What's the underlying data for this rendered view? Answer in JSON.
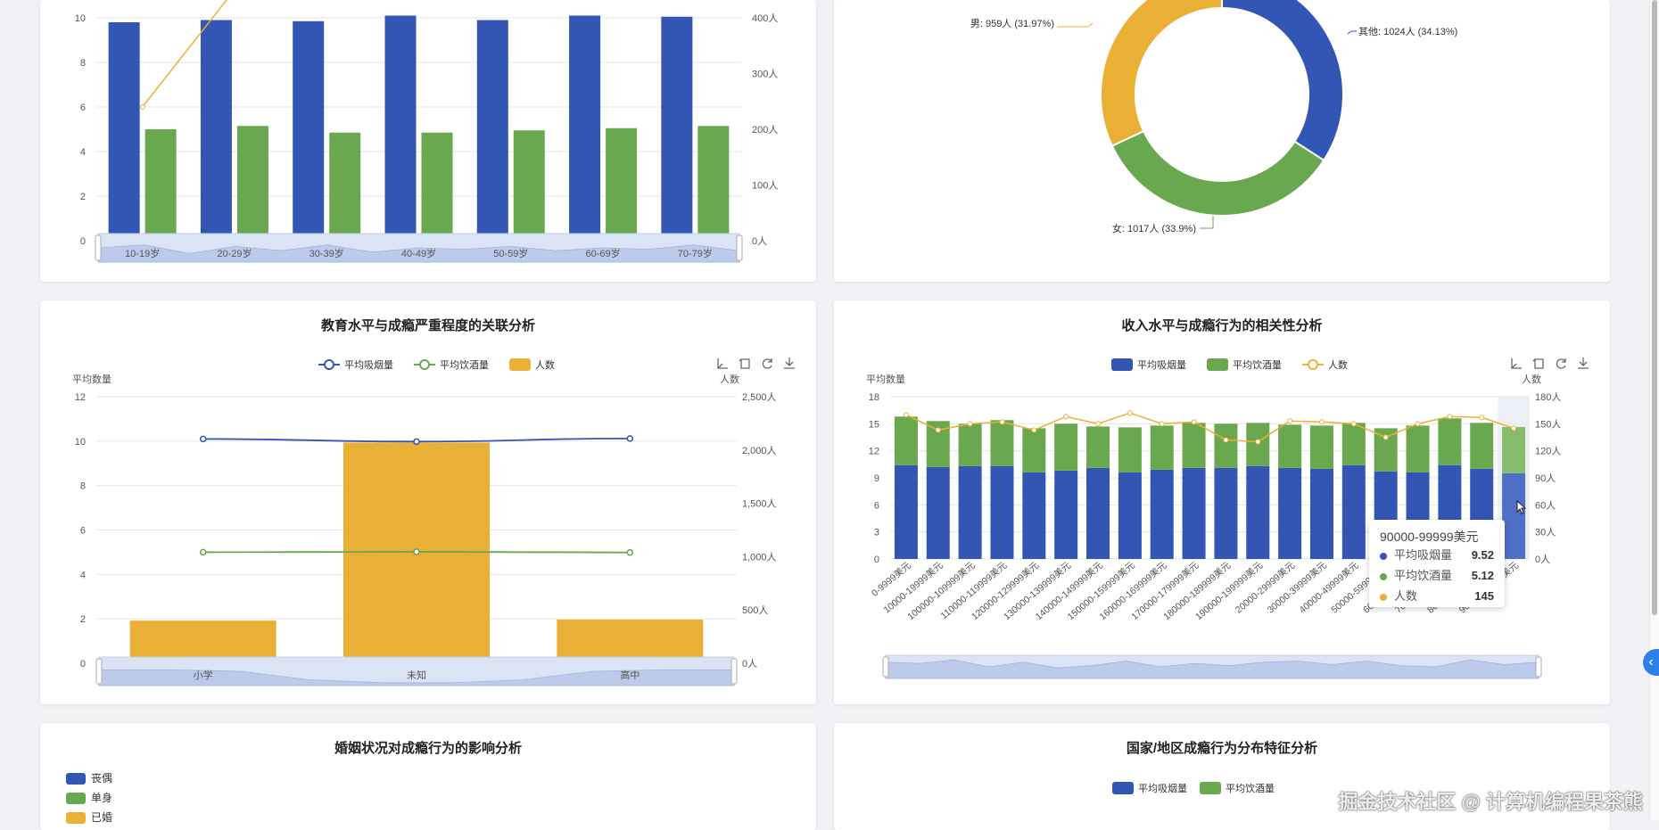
{
  "colors": {
    "blue": "#3355b4",
    "green": "#6aa84f",
    "orange": "#eab036"
  },
  "age_chart": {
    "y_left_ticks": [
      "10",
      "8",
      "6",
      "4",
      "2",
      "0"
    ],
    "y_right_ticks": [
      "400人",
      "300人",
      "200人",
      "100人",
      "0人"
    ],
    "categories": [
      "10-19岁",
      "20-29岁",
      "30-39岁",
      "40-49岁",
      "50-59岁",
      "60-69岁",
      "70-79岁"
    ]
  },
  "gender_chart": {
    "labels": {
      "male": "男: 959人 (31.97%)",
      "other": "其他: 1024人 (34.13%)",
      "female": "女: 1017人 (33.9%)"
    }
  },
  "edu_chart": {
    "title": "教育水平与成瘾严重程度的关联分析",
    "legend": [
      "平均吸烟量",
      "平均饮酒量",
      "人数"
    ],
    "y_left_name": "平均数量",
    "y_right_name": "人数",
    "y_left_ticks": [
      "12",
      "10",
      "8",
      "6",
      "4",
      "2",
      "0"
    ],
    "y_right_ticks": [
      "2,500人",
      "2,000人",
      "1,500人",
      "1,000人",
      "500人",
      "0人"
    ],
    "categories": [
      "小学",
      "未知",
      "高中"
    ]
  },
  "income_chart": {
    "title": "收入水平与成瘾行为的相关性分析",
    "legend": [
      "平均吸烟量",
      "平均饮酒量",
      "人数"
    ],
    "y_left_name": "平均数量",
    "y_right_name": "人数",
    "y_left_ticks": [
      "18",
      "15",
      "12",
      "9",
      "6",
      "3",
      "0"
    ],
    "y_right_ticks": [
      "180人",
      "150人",
      "120人",
      "90人",
      "60人",
      "30人",
      "0人"
    ],
    "categories": [
      "0-9999美元",
      "10000-19999美元",
      "100000-109999美元",
      "110000-119999美元",
      "120000-129999美元",
      "130000-139999美元",
      "140000-149999美元",
      "150000-159999美元",
      "160000-169999美元",
      "170000-179999美元",
      "180000-189999美元",
      "190000-199999美元",
      "20000-29999美元",
      "30000-39999美元",
      "40000-49999美元",
      "50000-59999美元",
      "60000-69999美元",
      "70000-79999美元",
      "80000-89999美元",
      "90000-99999美元"
    ],
    "tooltip": {
      "title": "90000-99999美元",
      "rows": [
        {
          "label": "平均吸烟量",
          "value": "9.52"
        },
        {
          "label": "平均饮酒量",
          "value": "5.12"
        },
        {
          "label": "人数",
          "value": "145"
        }
      ]
    }
  },
  "marital_chart": {
    "title": "婚姻状况对成瘾行为的影响分析",
    "legend": [
      "丧偶",
      "单身",
      "已婚"
    ]
  },
  "country_chart": {
    "title": "国家/地区成瘾行为分布特征分析",
    "legend": [
      "平均吸烟量",
      "平均饮酒量"
    ]
  },
  "watermark": "掘金技术社区 @ 计算机编程果茶熊",
  "chart_data": [
    {
      "type": "bar",
      "categories": [
        "10-19岁",
        "20-29岁",
        "30-39岁",
        "40-49岁",
        "50-59岁",
        "60-69岁",
        "70-79岁"
      ],
      "series": [
        {
          "name": "平均吸烟量",
          "values": [
            9.8,
            9.9,
            9.85,
            10.1,
            9.9,
            10.1,
            10.05
          ]
        },
        {
          "name": "平均饮酒量",
          "values": [
            5.0,
            5.15,
            4.85,
            4.85,
            4.95,
            5.05,
            5.15
          ]
        },
        {
          "name": "人数",
          "values": [
            240,
            450,
            450,
            450,
            440,
            450,
            450
          ]
        }
      ],
      "ylim": [
        0,
        10
      ],
      "y2lim": [
        0,
        400
      ]
    },
    {
      "type": "pie",
      "slices": [
        {
          "name": "其他",
          "value": 1024,
          "pct": 34.13
        },
        {
          "name": "女",
          "value": 1017,
          "pct": 33.9
        },
        {
          "name": "男",
          "value": 959,
          "pct": 31.97
        }
      ]
    },
    {
      "type": "bar",
      "title": "教育水平与成瘾严重程度的关联分析",
      "categories": [
        "小学",
        "未知",
        "高中"
      ],
      "series": [
        {
          "name": "平均吸烟量",
          "values": [
            10.1,
            9.98,
            10.12
          ]
        },
        {
          "name": "平均饮酒量",
          "values": [
            5.0,
            5.02,
            4.99
          ]
        },
        {
          "name": "人数",
          "values": [
            400,
            2070,
            410
          ]
        }
      ],
      "ylim": [
        0,
        12
      ],
      "y2lim": [
        0,
        2500
      ]
    },
    {
      "type": "bar",
      "title": "收入水平与成瘾行为的相关性分析",
      "categories": [
        "0-9999美元",
        "10000-19999美元",
        "100000-109999美元",
        "110000-119999美元",
        "120000-129999美元",
        "130000-139999美元",
        "140000-149999美元",
        "150000-159999美元",
        "160000-169999美元",
        "170000-179999美元",
        "180000-189999美元",
        "190000-199999美元",
        "20000-29999美元",
        "30000-39999美元",
        "40000-49999美元",
        "50000-59999美元",
        "60000-69999美元",
        "70000-79999美元",
        "80000-89999美元",
        "90000-99999美元"
      ],
      "series": [
        {
          "name": "平均吸烟量",
          "values": [
            10.4,
            10.2,
            10.3,
            10.3,
            9.6,
            9.8,
            10.1,
            9.6,
            9.9,
            10.1,
            10.1,
            10.3,
            10.1,
            10.0,
            10.4,
            9.7,
            9.6,
            10.4,
            10.0,
            9.52
          ]
        },
        {
          "name": "平均饮酒量",
          "values": [
            5.4,
            5.1,
            4.7,
            5.1,
            4.9,
            5.2,
            4.6,
            5.0,
            4.9,
            5.0,
            4.9,
            4.8,
            4.8,
            4.8,
            4.7,
            4.8,
            5.2,
            5.2,
            5.1,
            5.12
          ]
        },
        {
          "name": "人数",
          "values": [
            160,
            143,
            150,
            152,
            143,
            158,
            150,
            162,
            150,
            152,
            132,
            130,
            153,
            152,
            150,
            135,
            150,
            158,
            157,
            145
          ]
        }
      ],
      "ylim": [
        0,
        18
      ],
      "y2lim": [
        0,
        180
      ]
    }
  ]
}
